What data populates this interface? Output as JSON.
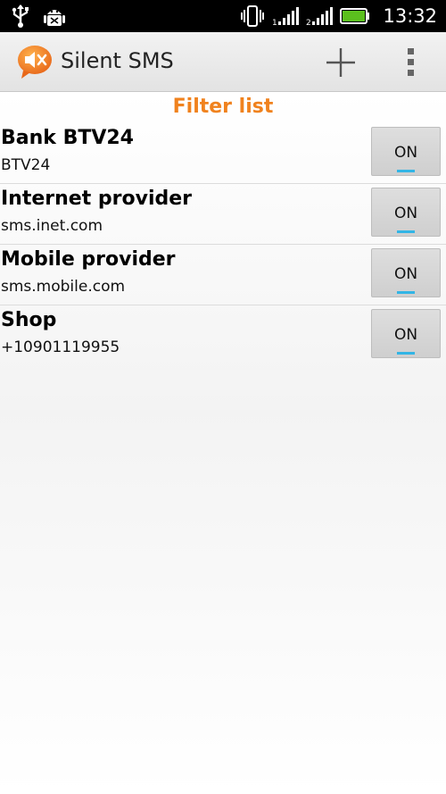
{
  "status_bar": {
    "time": "13:32",
    "icons": [
      "usb-icon",
      "android-debug-icon",
      "vibrate-icon",
      "signal-1-icon",
      "signal-2-icon",
      "battery-icon"
    ],
    "battery_color": "#5bbf1e"
  },
  "action_bar": {
    "title": "Silent SMS",
    "app_icon": "muted-speaker-bubble-icon",
    "actions": [
      "add-icon",
      "overflow-menu-icon"
    ],
    "brand_color": "#f0821e"
  },
  "main": {
    "section_title": "Filter list",
    "accent_color": "#f0821e",
    "indicator_color": "#33b5e5",
    "items": [
      {
        "name": "Bank BTV24",
        "address": "BTV24",
        "toggle": "ON"
      },
      {
        "name": "Internet provider",
        "address": "sms.inet.com",
        "toggle": "ON"
      },
      {
        "name": "Mobile provider",
        "address": "sms.mobile.com",
        "toggle": "ON"
      },
      {
        "name": "Shop",
        "address": "+10901119955",
        "toggle": "ON"
      }
    ]
  }
}
